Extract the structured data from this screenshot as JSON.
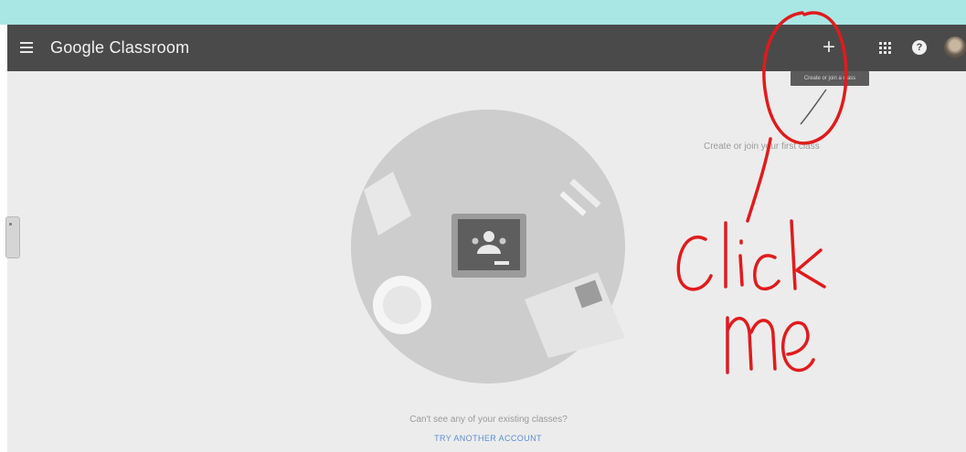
{
  "header": {
    "app_title": "Google Classroom",
    "create_button_label": "+",
    "create_tooltip": "Create or join a class",
    "help_label": "?"
  },
  "main": {
    "create_hint": "Create or join your first class",
    "cant_see_text": "Can't see any of your existing classes?",
    "try_another_account": "TRY ANOTHER ACCOUNT"
  },
  "annotation": {
    "handwriting": [
      "Click",
      "me"
    ],
    "ink_color": "#e01b1b"
  },
  "icons": {
    "menu": "hamburger-menu-icon",
    "apps": "apps-grid-icon",
    "help": "help-icon",
    "create": "plus-icon"
  },
  "colors": {
    "appbar": "#4a4a4a",
    "top_strip": "#a9e7e4",
    "page_background": "#ececec",
    "link": "#5b8fd8"
  }
}
